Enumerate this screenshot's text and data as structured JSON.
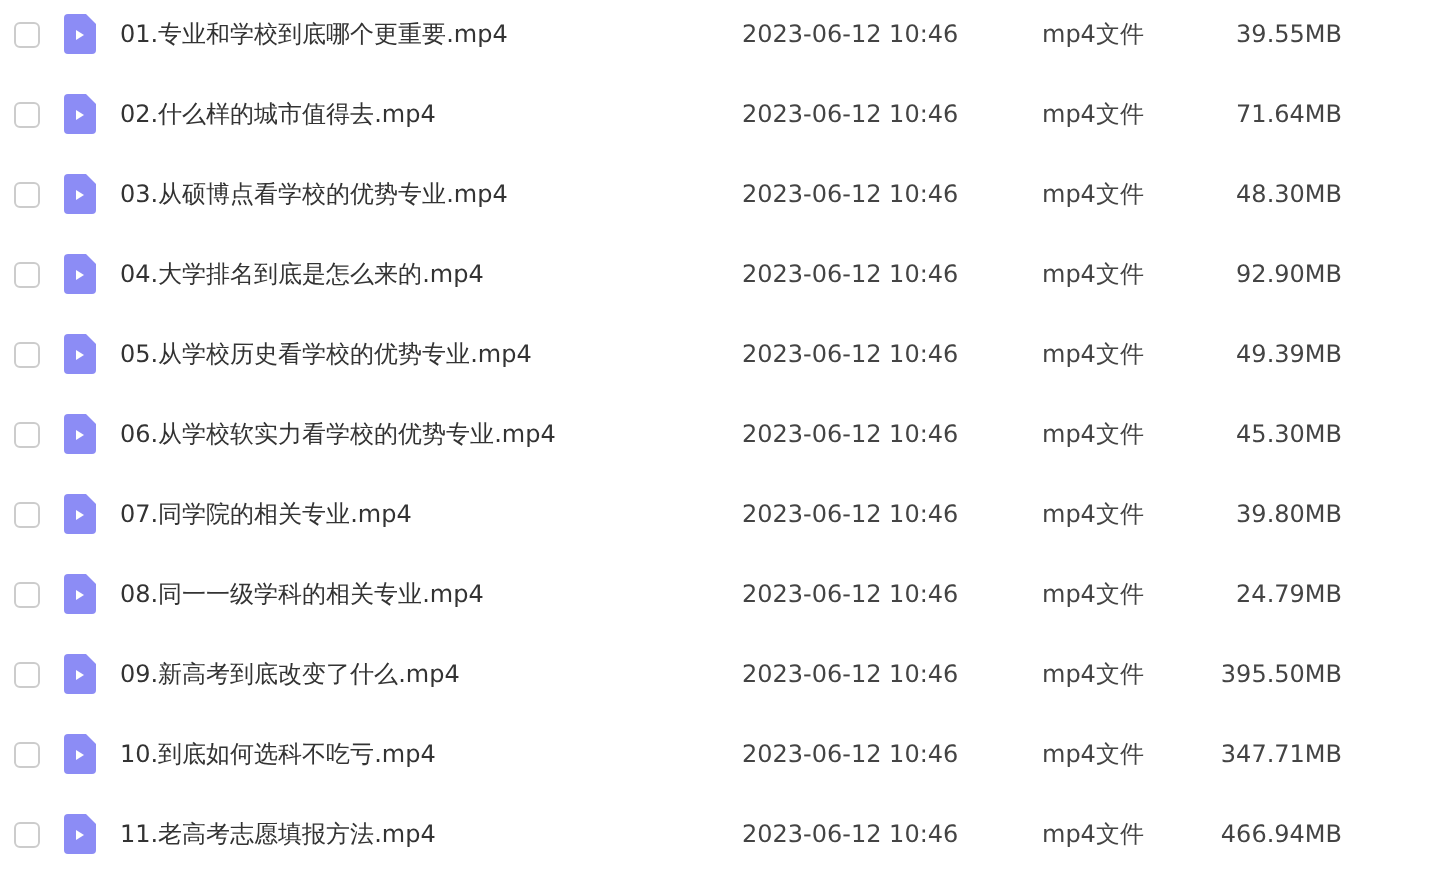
{
  "files": [
    {
      "name": "01.专业和学校到底哪个更重要.mp4",
      "date": "2023-06-12 10:46",
      "type": "mp4文件",
      "size": "39.55MB",
      "checked": false
    },
    {
      "name": "02.什么样的城市值得去.mp4",
      "date": "2023-06-12 10:46",
      "type": "mp4文件",
      "size": "71.64MB",
      "checked": false
    },
    {
      "name": "03.从硕博点看学校的优势专业.mp4",
      "date": "2023-06-12 10:46",
      "type": "mp4文件",
      "size": "48.30MB",
      "checked": false
    },
    {
      "name": "04.大学排名到底是怎么来的.mp4",
      "date": "2023-06-12 10:46",
      "type": "mp4文件",
      "size": "92.90MB",
      "checked": false
    },
    {
      "name": "05.从学校历史看学校的优势专业.mp4",
      "date": "2023-06-12 10:46",
      "type": "mp4文件",
      "size": "49.39MB",
      "checked": false
    },
    {
      "name": "06.从学校软实力看学校的优势专业.mp4",
      "date": "2023-06-12 10:46",
      "type": "mp4文件",
      "size": "45.30MB",
      "checked": false
    },
    {
      "name": "07.同学院的相关专业.mp4",
      "date": "2023-06-12 10:46",
      "type": "mp4文件",
      "size": "39.80MB",
      "checked": false
    },
    {
      "name": "08.同一一级学科的相关专业.mp4",
      "date": "2023-06-12 10:46",
      "type": "mp4文件",
      "size": "24.79MB",
      "checked": false
    },
    {
      "name": "09.新高考到底改变了什么.mp4",
      "date": "2023-06-12 10:46",
      "type": "mp4文件",
      "size": "395.50MB",
      "checked": false
    },
    {
      "name": "10.到底如何选科不吃亏.mp4",
      "date": "2023-06-12 10:46",
      "type": "mp4文件",
      "size": "347.71MB",
      "checked": false
    },
    {
      "name": "11.老高考志愿填报方法.mp4",
      "date": "2023-06-12 10:46",
      "type": "mp4文件",
      "size": "466.94MB",
      "checked": false
    }
  ]
}
